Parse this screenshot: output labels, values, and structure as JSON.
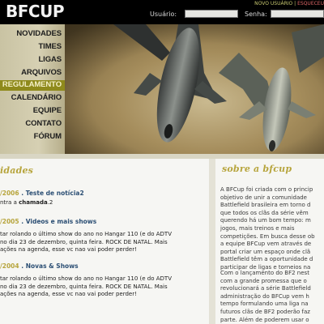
{
  "header": {
    "logo": "BFCUP",
    "usuario_label": "Usuário:",
    "senha_label": "Senha:",
    "novo_usuario": "NOVO USUÁRIO",
    "alt_link": "ESQUECEU"
  },
  "nav": {
    "items": [
      {
        "label": "NOVIDADES",
        "active": false
      },
      {
        "label": "TIMES",
        "active": false
      },
      {
        "label": "LIGAS",
        "active": false
      },
      {
        "label": "ARQUIVOS",
        "active": false
      },
      {
        "label": "REGULAMENTO",
        "active": true
      },
      {
        "label": "CALENDÁRIO",
        "active": false
      },
      {
        "label": "EQUIPE",
        "active": false
      },
      {
        "label": "CONTATO",
        "active": false
      },
      {
        "label": "FÓRUM",
        "active": false
      }
    ]
  },
  "news": {
    "title": "idades",
    "items": [
      {
        "date": "/2006",
        "sep": " . ",
        "headline": "Teste de notícia2",
        "body_prefix": "ntra a ",
        "body_bold": "chamada",
        "body_suffix": ".2"
      },
      {
        "date": "/2005",
        "sep": " . ",
        "headline": "Videos e mais shows",
        "body": "tar rolando o último show do ano no Hangar 110 (e do ADTV\nno dia 23 de dezembro, quinta feira. ROCK DE NATAL. Mais\nações na agenda, esse vc nao vai poder perder!"
      },
      {
        "date": "/2004",
        "sep": " . ",
        "headline": "Novas & Shows",
        "body": "tar rolando o último show do ano no Hangar 110 (e do ADTV\nno dia 23 de dezembro, quinta feira. ROCK DE NATAL. Mais\nações na agenda, esse vc nao vai poder perder!"
      }
    ]
  },
  "about": {
    "title": "sobre a bfcup",
    "paragraph1": "A BFCup foi criada com o princip\nobjetivo de unir a comunidade\nBattlefield brasileira em torno d\nque todos os clãs da série vêm\nquerendo há um bom tempo: m\njogos, mais treinos e mais\ncompetições. Em busca desse ob\na equipe BFCup vem através de\nportal criar um espaço onde clã\nBattlefield têm a oportunidade d\nparticipar de ligas e torneios na",
    "paragraph2": "Com o lançamento do BF2 nest\ncom a grande promessa que o\nrevolucionará a série Battlefield\nadministração do BFCup vem h\ntempo formulando uma liga na\nfuturos clãs de BF2 poderão faz\nparte. Além de poderem usar o\nservidores oficiais da BFCup par"
  },
  "colors": {
    "accent": "#b7a53d",
    "nav_active": "#8f8a1c",
    "headline": "#2c4f74"
  }
}
